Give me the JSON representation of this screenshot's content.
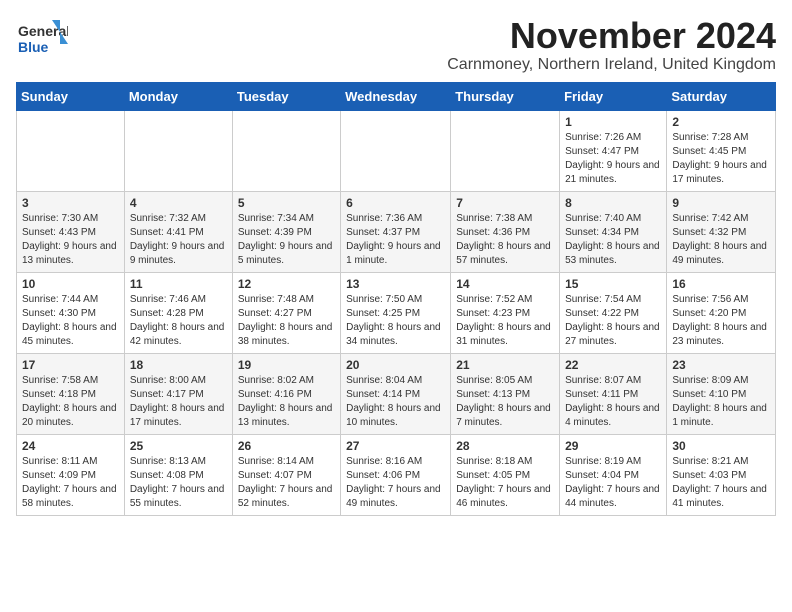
{
  "header": {
    "logo_general": "General",
    "logo_blue": "Blue",
    "month_title": "November 2024",
    "location": "Carnmoney, Northern Ireland, United Kingdom"
  },
  "calendar": {
    "days_of_week": [
      "Sunday",
      "Monday",
      "Tuesday",
      "Wednesday",
      "Thursday",
      "Friday",
      "Saturday"
    ],
    "weeks": [
      [
        {
          "day": "",
          "info": ""
        },
        {
          "day": "",
          "info": ""
        },
        {
          "day": "",
          "info": ""
        },
        {
          "day": "",
          "info": ""
        },
        {
          "day": "",
          "info": ""
        },
        {
          "day": "1",
          "info": "Sunrise: 7:26 AM\nSunset: 4:47 PM\nDaylight: 9 hours and 21 minutes."
        },
        {
          "day": "2",
          "info": "Sunrise: 7:28 AM\nSunset: 4:45 PM\nDaylight: 9 hours and 17 minutes."
        }
      ],
      [
        {
          "day": "3",
          "info": "Sunrise: 7:30 AM\nSunset: 4:43 PM\nDaylight: 9 hours and 13 minutes."
        },
        {
          "day": "4",
          "info": "Sunrise: 7:32 AM\nSunset: 4:41 PM\nDaylight: 9 hours and 9 minutes."
        },
        {
          "day": "5",
          "info": "Sunrise: 7:34 AM\nSunset: 4:39 PM\nDaylight: 9 hours and 5 minutes."
        },
        {
          "day": "6",
          "info": "Sunrise: 7:36 AM\nSunset: 4:37 PM\nDaylight: 9 hours and 1 minute."
        },
        {
          "day": "7",
          "info": "Sunrise: 7:38 AM\nSunset: 4:36 PM\nDaylight: 8 hours and 57 minutes."
        },
        {
          "day": "8",
          "info": "Sunrise: 7:40 AM\nSunset: 4:34 PM\nDaylight: 8 hours and 53 minutes."
        },
        {
          "day": "9",
          "info": "Sunrise: 7:42 AM\nSunset: 4:32 PM\nDaylight: 8 hours and 49 minutes."
        }
      ],
      [
        {
          "day": "10",
          "info": "Sunrise: 7:44 AM\nSunset: 4:30 PM\nDaylight: 8 hours and 45 minutes."
        },
        {
          "day": "11",
          "info": "Sunrise: 7:46 AM\nSunset: 4:28 PM\nDaylight: 8 hours and 42 minutes."
        },
        {
          "day": "12",
          "info": "Sunrise: 7:48 AM\nSunset: 4:27 PM\nDaylight: 8 hours and 38 minutes."
        },
        {
          "day": "13",
          "info": "Sunrise: 7:50 AM\nSunset: 4:25 PM\nDaylight: 8 hours and 34 minutes."
        },
        {
          "day": "14",
          "info": "Sunrise: 7:52 AM\nSunset: 4:23 PM\nDaylight: 8 hours and 31 minutes."
        },
        {
          "day": "15",
          "info": "Sunrise: 7:54 AM\nSunset: 4:22 PM\nDaylight: 8 hours and 27 minutes."
        },
        {
          "day": "16",
          "info": "Sunrise: 7:56 AM\nSunset: 4:20 PM\nDaylight: 8 hours and 23 minutes."
        }
      ],
      [
        {
          "day": "17",
          "info": "Sunrise: 7:58 AM\nSunset: 4:18 PM\nDaylight: 8 hours and 20 minutes."
        },
        {
          "day": "18",
          "info": "Sunrise: 8:00 AM\nSunset: 4:17 PM\nDaylight: 8 hours and 17 minutes."
        },
        {
          "day": "19",
          "info": "Sunrise: 8:02 AM\nSunset: 4:16 PM\nDaylight: 8 hours and 13 minutes."
        },
        {
          "day": "20",
          "info": "Sunrise: 8:04 AM\nSunset: 4:14 PM\nDaylight: 8 hours and 10 minutes."
        },
        {
          "day": "21",
          "info": "Sunrise: 8:05 AM\nSunset: 4:13 PM\nDaylight: 8 hours and 7 minutes."
        },
        {
          "day": "22",
          "info": "Sunrise: 8:07 AM\nSunset: 4:11 PM\nDaylight: 8 hours and 4 minutes."
        },
        {
          "day": "23",
          "info": "Sunrise: 8:09 AM\nSunset: 4:10 PM\nDaylight: 8 hours and 1 minute."
        }
      ],
      [
        {
          "day": "24",
          "info": "Sunrise: 8:11 AM\nSunset: 4:09 PM\nDaylight: 7 hours and 58 minutes."
        },
        {
          "day": "25",
          "info": "Sunrise: 8:13 AM\nSunset: 4:08 PM\nDaylight: 7 hours and 55 minutes."
        },
        {
          "day": "26",
          "info": "Sunrise: 8:14 AM\nSunset: 4:07 PM\nDaylight: 7 hours and 52 minutes."
        },
        {
          "day": "27",
          "info": "Sunrise: 8:16 AM\nSunset: 4:06 PM\nDaylight: 7 hours and 49 minutes."
        },
        {
          "day": "28",
          "info": "Sunrise: 8:18 AM\nSunset: 4:05 PM\nDaylight: 7 hours and 46 minutes."
        },
        {
          "day": "29",
          "info": "Sunrise: 8:19 AM\nSunset: 4:04 PM\nDaylight: 7 hours and 44 minutes."
        },
        {
          "day": "30",
          "info": "Sunrise: 8:21 AM\nSunset: 4:03 PM\nDaylight: 7 hours and 41 minutes."
        }
      ]
    ]
  }
}
